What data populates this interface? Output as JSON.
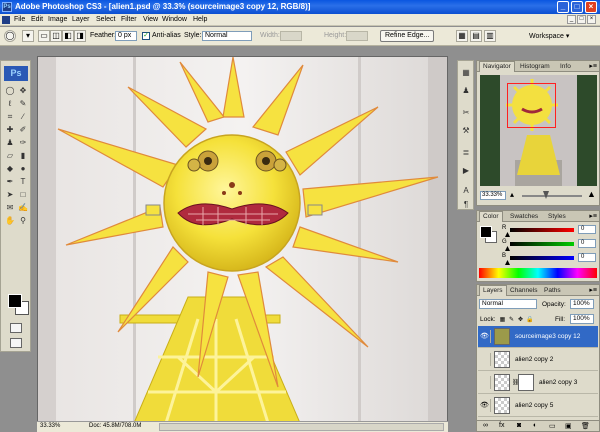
{
  "window": {
    "title": "Adobe Photoshop CS3 - [alien1.psd @ 33.3% (sourceimage3 copy 12, RGB/8)]",
    "app_icon": "Ps",
    "minimize": "_",
    "maximize": "□",
    "close": "×"
  },
  "menu": {
    "items": [
      "File",
      "Edit",
      "Image",
      "Layer",
      "Select",
      "Filter",
      "View",
      "Window",
      "Help"
    ],
    "doc_buttons": [
      "_",
      "□",
      "×"
    ]
  },
  "options": {
    "feather_label": "Feather:",
    "feather_value": "0 px",
    "antialias_label": "Anti-alias",
    "antialias_checked": "✓",
    "style_label": "Style:",
    "style_value": "Normal",
    "width_label": "Width:",
    "height_label": "Height:",
    "refine_edge": "Refine Edge...",
    "workspace": "Workspace ▾"
  },
  "toolbox": {
    "logo": "Ps"
  },
  "document": {
    "zoom": "33.33%",
    "doc_size": "Doc: 45.8M/708.0M"
  },
  "navigator": {
    "tabs": [
      "Navigator",
      "Histogram",
      "Info"
    ],
    "zoom": "33.33%"
  },
  "color_panel": {
    "tabs": [
      "Color",
      "Swatches",
      "Styles"
    ],
    "channels": [
      {
        "label": "R",
        "value": "0",
        "color": "#ff0000"
      },
      {
        "label": "G",
        "value": "0",
        "color": "#00cc00"
      },
      {
        "label": "B",
        "value": "0",
        "color": "#0000ff"
      }
    ]
  },
  "layers_panel": {
    "tabs": [
      "Layers",
      "Channels",
      "Paths"
    ],
    "blend_mode": "Normal",
    "opacity_label": "Opacity:",
    "opacity_value": "100%",
    "lock_label": "Lock:",
    "fill_label": "Fill:",
    "fill_value": "100%",
    "layers": [
      {
        "name": "sourceimage3 copy 12",
        "selected": true,
        "visible": true
      },
      {
        "name": "alien2 copy 2",
        "selected": false,
        "visible": false
      },
      {
        "name": "alien2 copy 3",
        "selected": false,
        "visible": false
      },
      {
        "name": "alien2 copy 5",
        "selected": false,
        "visible": true
      }
    ],
    "footer_icons": [
      "link-icon",
      "fx-icon",
      "mask-icon",
      "adjustment-icon",
      "group-icon",
      "new-layer-icon",
      "trash-icon"
    ]
  },
  "colors": {
    "title_bar": "#0a56e0",
    "selected_layer": "#3169c6",
    "sun_yellow": "#f5e13a",
    "nav_box": "#ff2020"
  }
}
